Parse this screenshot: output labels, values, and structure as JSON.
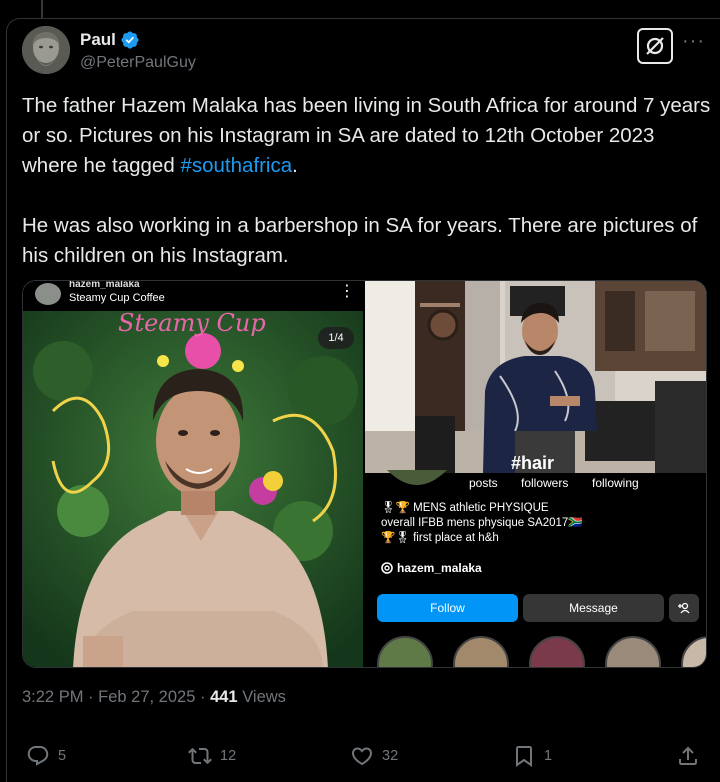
{
  "author": {
    "name": "Paul",
    "handle": "@PeterPaulGuy",
    "verified": true
  },
  "tweet": {
    "para1_pre": "The father Hazem Malaka  has been living in South Africa for around 7 years or so. Pictures on his Instagram in SA are dated to  12th October 2023 where he tagged ",
    "hashtag": "#southafrica",
    "para1_post": ".",
    "para2": "He was also working in a barbershop in SA for years. There are pictures of his children on his Instagram."
  },
  "media": {
    "left": {
      "username": "hazem_malaka",
      "location": "Steamy Cup Coffee",
      "counter": "1/4",
      "sign_text": "Steamy Cup"
    },
    "right": {
      "tag": "#hair",
      "stats": [
        "posts",
        "followers",
        "following"
      ],
      "bio_lines": [
        "🎖🏆 MENS  athletic PHYSIQUE",
        "overall IFBB mens physique SA2017🇿🇦",
        "🏆🎖 first place at h&h"
      ],
      "threads_handle": "hazem_malaka",
      "follow_label": "Follow",
      "message_label": "Message"
    }
  },
  "meta": {
    "time": "3:22 PM",
    "date": "Feb 27, 2025",
    "views_count": "441",
    "views_label": "Views"
  },
  "actions": {
    "replies": "5",
    "reposts": "12",
    "likes": "32",
    "bookmarks": "1"
  },
  "colors": {
    "accent": "#1d9bf0",
    "follow": "#0095f6",
    "muted": "#71767b"
  }
}
